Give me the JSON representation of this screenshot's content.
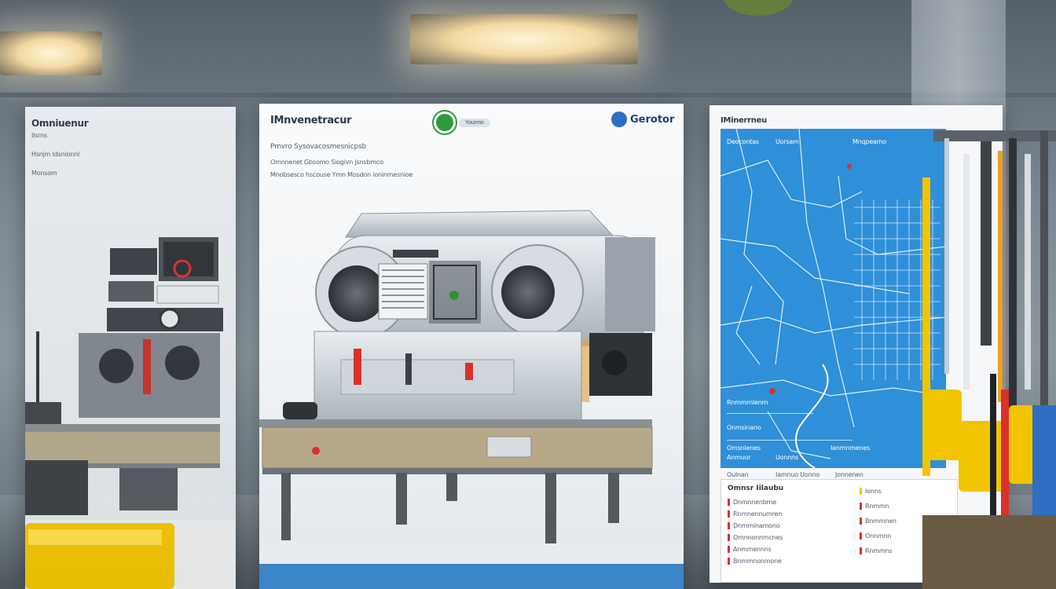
{
  "panels": {
    "left": {
      "title": "Omniuenur",
      "lines": [
        "Ilsrns",
        "Hsnjm Idsnionnl",
        "Monsom"
      ]
    },
    "center": {
      "title": "IMnvenetracur",
      "logo_text": "Yourmn",
      "brand": "Gerotor",
      "headline": "Pmvro Sysovacosmesnicpsb",
      "subline_1": "Omnnenet Gbsomo Siogivn Jsnsbmco",
      "subline_2": "Mnobsesco hscouse Ymn Mosdon ioninmesnioe"
    },
    "right": {
      "title": "IMinerrneu",
      "map_labels": [
        "Deocontas",
        "Uorsam",
        "Mnqpeamo"
      ],
      "footer_rows": [
        {
          "a": "Rnmmmlenm",
          "b": ""
        },
        {
          "a": "Onmsinano",
          "b": ""
        },
        {
          "a": "Omsnlenes",
          "b": "Ianmnmenes"
        },
        {
          "a": "Anmuor",
          "b": "Uonnns"
        },
        {
          "a": "Oulnan",
          "b": "Iamnuo  Uonno",
          "c": "Jonnenen"
        }
      ],
      "info_box": {
        "title": "Omnsr Iilaubu",
        "items": [
          "Dnmnnenbme",
          "Rnmnennumren",
          "Dnmminamono",
          "Omnnonnmcnes",
          "Anmmennns",
          "Bnmmnonmone"
        ],
        "side_items": [
          "Ionns",
          "Rnmmn",
          "Bnmmnen",
          "Onnmnn",
          "Rnmmns"
        ]
      }
    }
  },
  "colors": {
    "panel_blue": "#3b86c8",
    "map_blue": "#2f8fd8",
    "accent_red": "#d8322a",
    "bin_yellow": "#f2c400"
  }
}
